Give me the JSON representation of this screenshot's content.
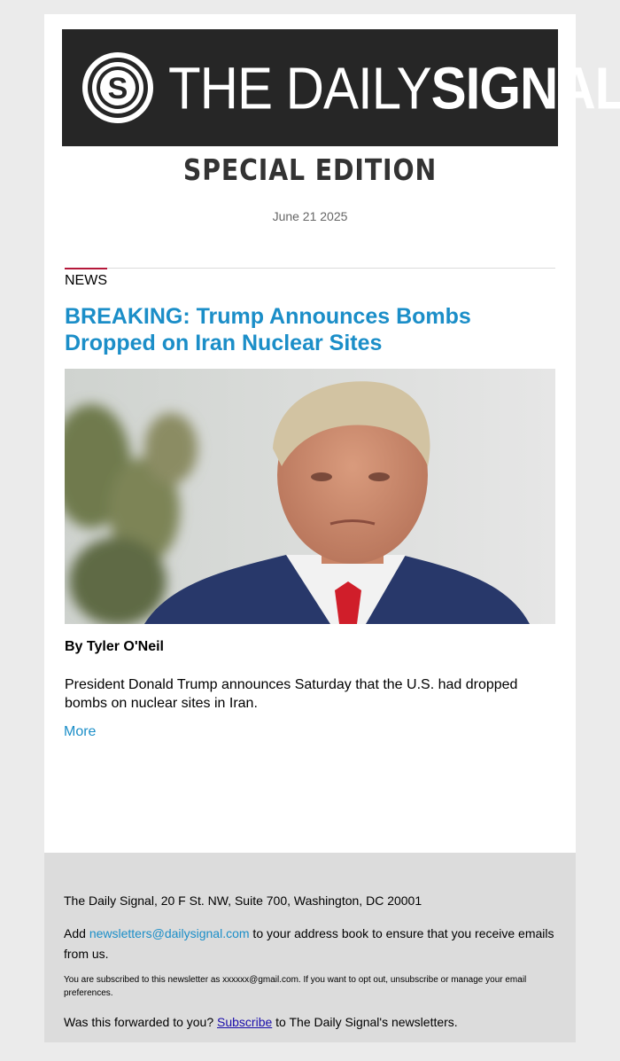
{
  "brand": {
    "logo_text_light": "THE DAILY ",
    "logo_text_bold": "SIGNAL",
    "logo_icon": "s-logo-icon"
  },
  "edition_title": "SPECIAL EDITION",
  "date": "June 21 2025",
  "article": {
    "section": "NEWS",
    "headline": "BREAKING: Trump Announces Bombs Dropped on Iran Nuclear Sites",
    "image_description_icon": "portrait-photo",
    "byline": "By Tyler O'Neil",
    "summary": "President Donald Trump announces Saturday that the U.S. had dropped bombs on nuclear sites in Iran.",
    "more_label": "More"
  },
  "footer": {
    "address": "The Daily Signal, 20 F St. NW, Suite 700, Washington, DC 20001",
    "add_prefix": "Add ",
    "add_email": "newsletters@dailysignal.com",
    "add_suffix": " to your address book to ensure that you receive emails from us.",
    "subscribed_notice": "You are subscribed to this newsletter as xxxxxx@gmail.com. If you want to opt out, unsubscribe or manage your email preferences.",
    "forwarded_prefix": "Was this forwarded to you? ",
    "subscribe_label": "Subscribe",
    "forwarded_suffix": " to The Daily Signal's newsletters."
  },
  "colors": {
    "accent_blue": "#1b8ec8",
    "accent_red": "#b5183a",
    "masthead_bg": "#262626"
  }
}
